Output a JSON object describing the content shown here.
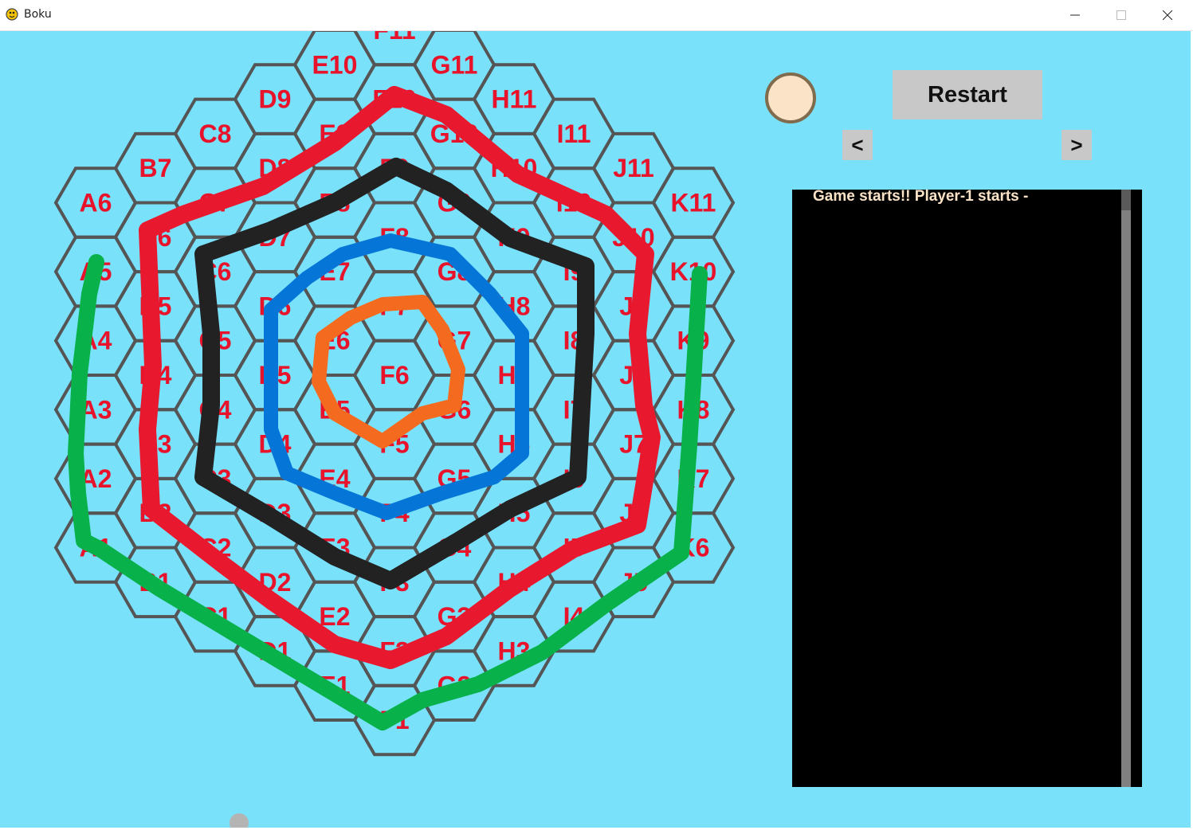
{
  "window": {
    "title": "Boku",
    "app_icon": "pygame-snake-icon"
  },
  "controls": {
    "restart_label": "Restart",
    "prev_label": "<",
    "next_label": ">",
    "turn_indicator": {
      "player_color": "#fbe3c7",
      "border_color": "#806b4d"
    }
  },
  "log": {
    "lines": [
      "Game starts!! Player-1 starts -"
    ]
  },
  "board": {
    "background": "#79e1fa",
    "line_color": "#555555",
    "label_color": "#e8122a",
    "columns": [
      {
        "letter": "A",
        "start": 1,
        "count": 6
      },
      {
        "letter": "B",
        "start": 1,
        "count": 7
      },
      {
        "letter": "C",
        "start": 1,
        "count": 8
      },
      {
        "letter": "D",
        "start": 1,
        "count": 9
      },
      {
        "letter": "E",
        "start": 1,
        "count": 10
      },
      {
        "letter": "F",
        "start": 1,
        "count": 11
      },
      {
        "letter": "G",
        "start": 2,
        "count": 10
      },
      {
        "letter": "H",
        "start": 3,
        "count": 9
      },
      {
        "letter": "I",
        "start": 4,
        "count": 8
      },
      {
        "letter": "J",
        "start": 5,
        "count": 7
      },
      {
        "letter": "K",
        "start": 6,
        "count": 6
      }
    ],
    "ring_colors": {
      "green": "#08b14a",
      "red": "#e8192f",
      "black": "#222222",
      "blue": "#0575d8",
      "orange": "#f46b20"
    }
  }
}
